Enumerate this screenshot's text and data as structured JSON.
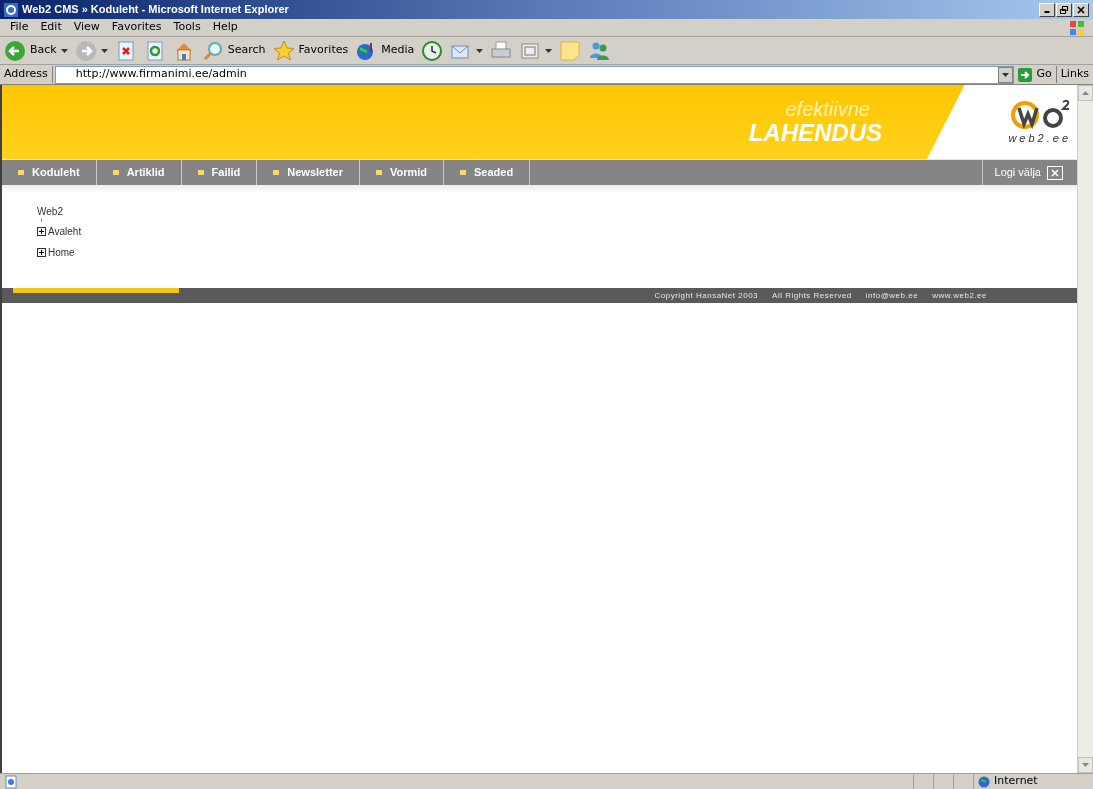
{
  "window": {
    "title": "Web2 CMS » Koduleht - Microsoft Internet Explorer"
  },
  "menu": [
    "File",
    "Edit",
    "View",
    "Favorites",
    "Tools",
    "Help"
  ],
  "toolbar": [
    {
      "kind": "back",
      "label": "Back"
    },
    {
      "kind": "forward"
    },
    {
      "kind": "stop"
    },
    {
      "kind": "refresh"
    },
    {
      "kind": "home"
    },
    {
      "kind": "search",
      "label": "Search"
    },
    {
      "kind": "favorites",
      "label": "Favorites"
    },
    {
      "kind": "media",
      "label": "Media"
    },
    {
      "kind": "history"
    },
    {
      "kind": "mail"
    },
    {
      "kind": "print"
    },
    {
      "kind": "edit"
    },
    {
      "kind": "note"
    },
    {
      "kind": "people"
    }
  ],
  "address": {
    "label": "Address",
    "value": "http://www.firmanimi.ee/admin",
    "go": "Go",
    "links": "Links"
  },
  "banner": {
    "line1": "efektiivne",
    "line2": "LAHENDUS",
    "logo_caption": "web2.ee"
  },
  "nav": {
    "items": [
      "Koduleht",
      "Artiklid",
      "Failid",
      "Newsletter",
      "Vormid",
      "Seaded"
    ],
    "logout": "Logi välja"
  },
  "tree": {
    "label": "Web2",
    "children": [
      {
        "label": "Avaleht",
        "expanded": false
      },
      {
        "label": "Home",
        "expanded": false
      }
    ]
  },
  "footer": [
    "Copyright HansaNet 2003",
    "All Rights Reserved",
    "info@web.ee",
    "www.web2.ee"
  ],
  "status_bar": {
    "zone": "Internet"
  }
}
